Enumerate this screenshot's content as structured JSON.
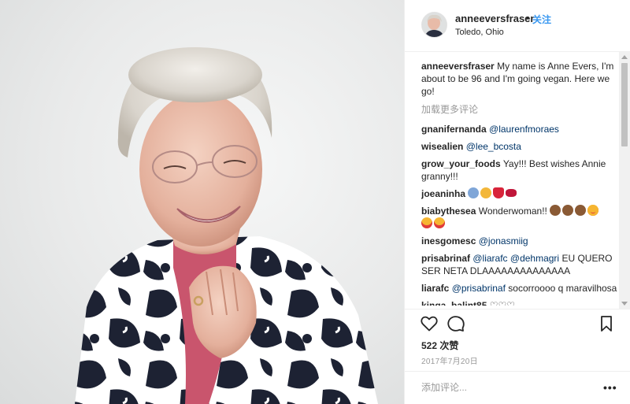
{
  "post": {
    "username": "anneeversfraser",
    "dot": "•",
    "follow_label": "关注",
    "location": "Toledo, Ohio"
  },
  "caption": {
    "username": "anneeversfraser",
    "text": "My name is Anne Evers, I'm about to be 96 and I'm going vegan. Here we go!"
  },
  "load_more_label": "加载更多评论",
  "comments": [
    {
      "username": "gnanifernanda",
      "mention": "@laurenfmoraes",
      "text": ""
    },
    {
      "username": "wisealien",
      "mention": "@lee_bcosta",
      "text": ""
    },
    {
      "username": "grow_your_foods",
      "mention": "",
      "text": "Yay!!! Best wishes Annie granny!!!"
    },
    {
      "username": "joeaninha",
      "mention": "",
      "text": "",
      "emojis": [
        "praying-hands-emoji",
        "clap-emoji",
        "red-heart-emoji",
        "kiss-lips-emoji"
      ]
    },
    {
      "username": "biabythesea",
      "mention": "",
      "text": "Wonderwoman!!",
      "emojis": [
        "clap-emoji",
        "clap-emoji",
        "clap-emoji",
        "heart-eyes-emoji",
        "heart-eyes-emoji",
        "heart-eyes-emoji"
      ]
    },
    {
      "username": "inesgomesc",
      "mention": "@jonasmiig",
      "text": ""
    },
    {
      "username": "prisabrinaf",
      "mention": "@liarafc @dehmagri",
      "text": "EU QUERO SER NETA DLAAAAAAAAAAAAAA"
    },
    {
      "username": "liarafc",
      "mention": "@prisabrinaf",
      "text": "socorroooo q maravilhosa"
    },
    {
      "username": "kinga_balint85",
      "mention": "",
      "text": "♡♡♡"
    }
  ],
  "actions": {
    "like_icon": "heart-icon",
    "comment_icon": "comment-bubble-icon",
    "save_icon": "bookmark-icon"
  },
  "likes_text": "522 次赞",
  "date_text": "2017年7月20日",
  "add_comment": {
    "placeholder": "添加评论...",
    "more_label": "•••"
  },
  "colors": {
    "link": "#003569",
    "follow": "#3897f0",
    "muted": "#999999",
    "text": "#262626"
  }
}
